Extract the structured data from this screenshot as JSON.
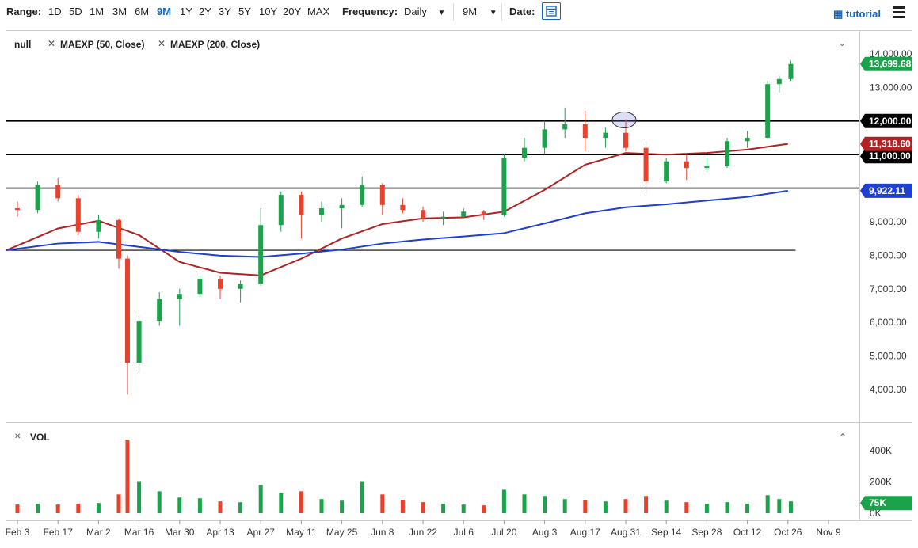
{
  "toolbar": {
    "range_label": "Range:",
    "ranges": [
      "1D",
      "5D",
      "1M",
      "3M",
      "6M",
      "9M",
      "1Y",
      "2Y",
      "3Y",
      "5Y",
      "10Y",
      "20Y",
      "MAX"
    ],
    "active_range": "9M",
    "frequency_label": "Frequency:",
    "frequency_value": "Daily",
    "period_value": "9M",
    "date_label": "Date:",
    "tutorial_label": "tutorial"
  },
  "legend": {
    "items": [
      "null",
      "MAEXP (50, Close)",
      "MAEXP (200, Close)"
    ]
  },
  "volume_panel": {
    "label": "VOL"
  },
  "colors": {
    "up": "#1aa34a",
    "down": "#e8412c",
    "ma50": "#b22222",
    "ma200": "#1f3fcf",
    "price_badge": "#1aa34a",
    "ma50_badge": "#b22222",
    "ma200_badge": "#1f3fcf",
    "level_badge": "#000000"
  },
  "chart_data": {
    "type": "candlestick",
    "price_axis": {
      "ticks": [
        "4,000.00",
        "5,000.00",
        "6,000.00",
        "7,000.00",
        "8,000.00",
        "9,000.00",
        "10,000.00",
        "11,000.00",
        "12,000.00",
        "13,000.00",
        "14,000.00"
      ],
      "ylim": [
        3500,
        14300
      ]
    },
    "volume_axis": {
      "ticks": [
        "0K",
        "200K",
        "400K"
      ],
      "ylim": [
        0,
        520000
      ]
    },
    "x_tick_labels": [
      "Feb 3",
      "Feb 17",
      "Mar 2",
      "Mar 16",
      "Mar 30",
      "Apr 13",
      "Apr 27",
      "May 11",
      "May 25",
      "Jun 8",
      "Jun 22",
      "Jul 6",
      "Jul 20",
      "Aug 3",
      "Aug 17",
      "Aug 31",
      "Sep 14",
      "Sep 28",
      "Oct 12",
      "Oct 26",
      "Nov 9"
    ],
    "horizontal_levels": [
      12000,
      11000,
      10000,
      8150
    ],
    "badges": {
      "last_price": "13,699.68",
      "level_12000": "12,000.00",
      "ma50": "11,318.60",
      "level_11000": "11,000.00",
      "ma200": "9,922.11",
      "last_volume": "75K"
    },
    "circle_annotation": {
      "x_label": "Aug 31",
      "y": 12030
    },
    "series": [
      {
        "name": "MAEXP (50, Close)",
        "type": "line",
        "x": [
          "Feb 3",
          "Feb 17",
          "Mar 2",
          "Mar 16",
          "Mar 30",
          "Apr 13",
          "Apr 27",
          "May 11",
          "May 25",
          "Jun 8",
          "Jun 22",
          "Jul 6",
          "Jul 20",
          "Aug 3",
          "Aug 17",
          "Aug 31",
          "Sep 14",
          "Sep 28",
          "Oct 12",
          "Oct 26"
        ],
        "values": [
          8150,
          8800,
          9030,
          8600,
          7800,
          7480,
          7400,
          7900,
          8500,
          8930,
          9100,
          9130,
          9300,
          9950,
          10700,
          11050,
          11000,
          11050,
          11150,
          11320
        ]
      },
      {
        "name": "MAEXP (200, Close)",
        "type": "line",
        "x": [
          "Feb 3",
          "Feb 17",
          "Mar 2",
          "Mar 16",
          "Mar 30",
          "Apr 13",
          "Apr 27",
          "May 11",
          "May 25",
          "Jun 8",
          "Jun 22",
          "Jul 6",
          "Jul 20",
          "Aug 3",
          "Aug 17",
          "Aug 31",
          "Sep 14",
          "Sep 28",
          "Oct 12",
          "Oct 26"
        ],
        "values": [
          8150,
          8350,
          8400,
          8250,
          8100,
          7990,
          7950,
          8050,
          8170,
          8350,
          8470,
          8560,
          8660,
          8950,
          9250,
          9430,
          9520,
          9630,
          9740,
          9922
        ]
      },
      {
        "name": "candles",
        "type": "candlestick",
        "fields": [
          "x",
          "open",
          "high",
          "low",
          "close",
          "volume"
        ],
        "points": [
          [
            "Feb 3",
            9400,
            9600,
            9150,
            9350,
            55000
          ],
          [
            "Feb 10",
            9350,
            10200,
            9250,
            10100,
            60000
          ],
          [
            "Feb 17",
            10100,
            10300,
            9600,
            9700,
            55000
          ],
          [
            "Feb 24",
            9700,
            9800,
            8600,
            8700,
            60000
          ],
          [
            "Mar 2",
            8700,
            9200,
            8500,
            9050,
            65000
          ],
          [
            "Mar 9",
            9050,
            9100,
            7600,
            7900,
            120000
          ],
          [
            "Mar 12",
            7900,
            8000,
            3850,
            4800,
            470000
          ],
          [
            "Mar 16",
            4800,
            6200,
            4500,
            6050,
            200000
          ],
          [
            "Mar 23",
            6050,
            6900,
            5900,
            6700,
            140000
          ],
          [
            "Mar 30",
            6700,
            7000,
            5900,
            6850,
            100000
          ],
          [
            "Apr 6",
            6850,
            7400,
            6750,
            7300,
            95000
          ],
          [
            "Apr 13",
            7300,
            7400,
            6700,
            7000,
            75000
          ],
          [
            "Apr 20",
            7000,
            7250,
            6600,
            7150,
            70000
          ],
          [
            "Apr 27",
            7150,
            9400,
            7100,
            8900,
            180000
          ],
          [
            "May 4",
            8900,
            9900,
            8700,
            9800,
            130000
          ],
          [
            "May 11",
            9800,
            9900,
            8500,
            9200,
            140000
          ],
          [
            "May 18",
            9200,
            9600,
            9000,
            9400,
            90000
          ],
          [
            "May 25",
            9400,
            9700,
            8800,
            9500,
            80000
          ],
          [
            "Jun 1",
            9500,
            10350,
            9450,
            10100,
            200000
          ],
          [
            "Jun 8",
            10100,
            10150,
            9200,
            9500,
            120000
          ],
          [
            "Jun 15",
            9500,
            9700,
            9250,
            9350,
            85000
          ],
          [
            "Jun 22",
            9350,
            9450,
            9000,
            9100,
            70000
          ],
          [
            "Jun 29",
            9100,
            9300,
            8900,
            9150,
            60000
          ],
          [
            "Jul 6",
            9150,
            9400,
            9100,
            9300,
            55000
          ],
          [
            "Jul 13",
            9300,
            9350,
            9050,
            9200,
            50000
          ],
          [
            "Jul 20",
            9200,
            11000,
            9150,
            10900,
            150000
          ],
          [
            "Jul 27",
            10900,
            11500,
            10800,
            11200,
            120000
          ],
          [
            "Aug 3",
            11200,
            12000,
            11000,
            11750,
            110000
          ],
          [
            "Aug 10",
            11750,
            12400,
            11500,
            11900,
            90000
          ],
          [
            "Aug 17",
            11900,
            12300,
            11100,
            11500,
            85000
          ],
          [
            "Aug 24",
            11500,
            11800,
            11200,
            11650,
            75000
          ],
          [
            "Aug 31",
            11650,
            12050,
            11100,
            11200,
            90000
          ],
          [
            "Sep 7",
            11200,
            11400,
            9850,
            10200,
            110000
          ],
          [
            "Sep 14",
            10200,
            10900,
            10150,
            10800,
            80000
          ],
          [
            "Sep 21",
            10800,
            11000,
            10250,
            10600,
            70000
          ],
          [
            "Sep 28",
            10600,
            10900,
            10500,
            10650,
            60000
          ],
          [
            "Oct 5",
            10650,
            11500,
            10600,
            11400,
            70000
          ],
          [
            "Oct 12",
            11400,
            11700,
            11200,
            11500,
            60000
          ],
          [
            "Oct 19",
            11500,
            13200,
            11450,
            13100,
            115000
          ],
          [
            "Oct 23",
            13100,
            13350,
            12850,
            13250,
            90000
          ],
          [
            "Oct 27",
            13250,
            13800,
            13200,
            13700,
            75000
          ]
        ]
      }
    ]
  }
}
